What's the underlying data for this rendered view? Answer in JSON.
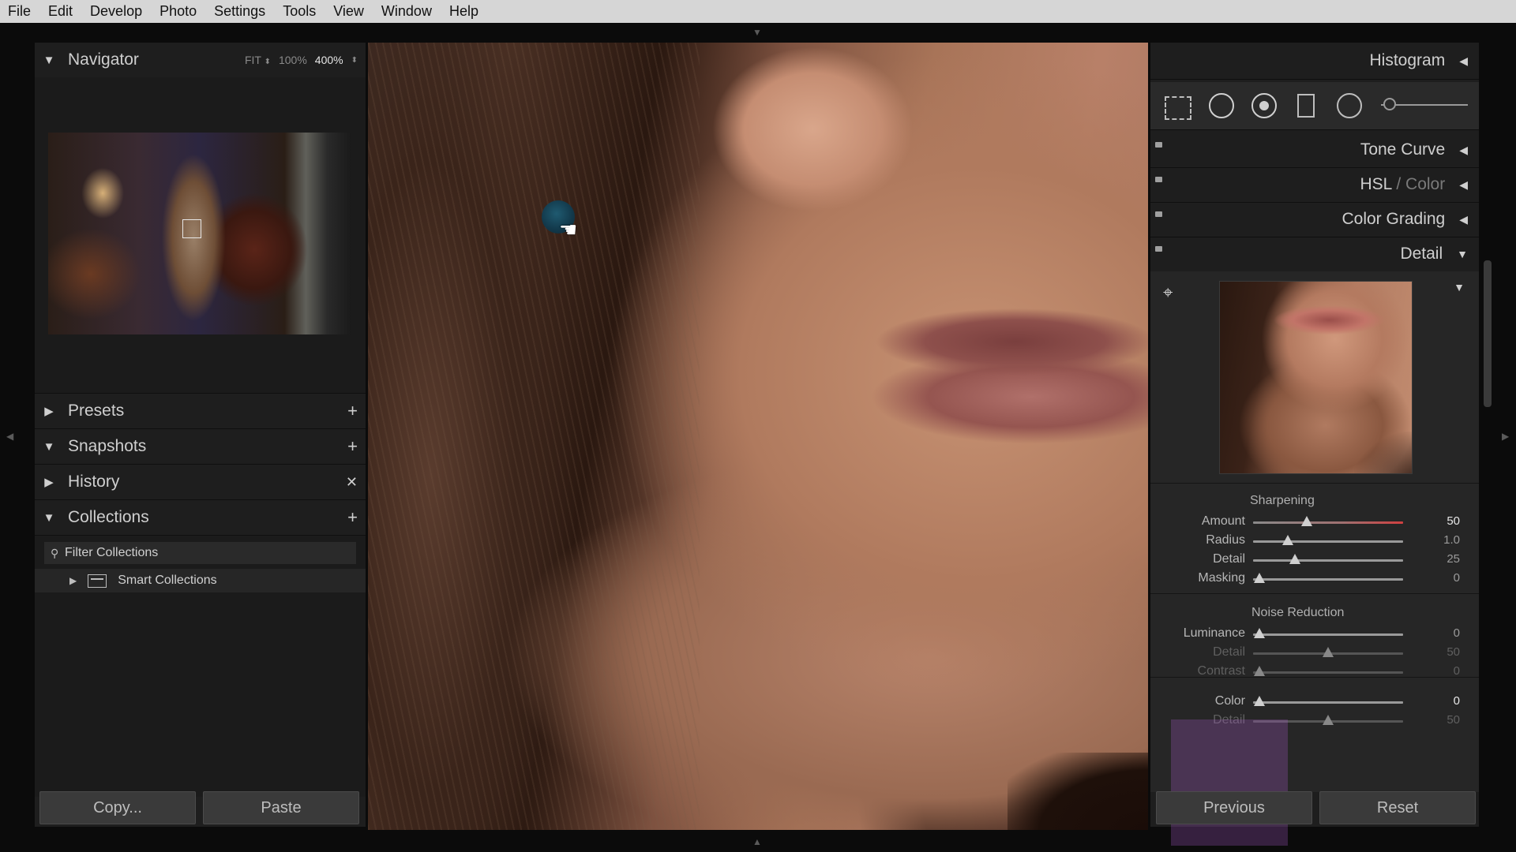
{
  "menu": [
    "File",
    "Edit",
    "Develop",
    "Photo",
    "Settings",
    "Tools",
    "View",
    "Window",
    "Help"
  ],
  "left": {
    "navigator": {
      "title": "Navigator",
      "zoom_fit": "FIT",
      "zoom_100": "100%",
      "zoom_current": "400%"
    },
    "presets": {
      "title": "Presets"
    },
    "snapshots": {
      "title": "Snapshots"
    },
    "history": {
      "title": "History"
    },
    "collections": {
      "title": "Collections",
      "filter_label": "Filter Collections",
      "items": [
        {
          "label": "Smart Collections"
        }
      ]
    },
    "buttons": {
      "copy": "Copy...",
      "paste": "Paste"
    }
  },
  "right": {
    "panels": {
      "histogram": "Histogram",
      "tone_curve": "Tone Curve",
      "hsl": "HSL",
      "hsl_sep": " / ",
      "color": "Color",
      "color_grading": "Color Grading",
      "detail": "Detail"
    },
    "sharpening": {
      "title": "Sharpening",
      "sliders": [
        {
          "label": "Amount",
          "value": "50",
          "pos": 0.357
        },
        {
          "label": "Radius",
          "value": "1.0",
          "pos": 0.23
        },
        {
          "label": "Detail",
          "value": "25",
          "pos": 0.28
        },
        {
          "label": "Masking",
          "value": "0",
          "pos": 0.04
        }
      ]
    },
    "noise_reduction": {
      "title": "Noise Reduction",
      "sliders": [
        {
          "label": "Luminance",
          "value": "0",
          "pos": 0.04
        },
        {
          "label": "Detail",
          "value": "50",
          "pos": 0.5
        },
        {
          "label": "Contrast",
          "value": "0",
          "pos": 0.04
        },
        {
          "label": "Color",
          "value": "0",
          "pos": 0.04
        },
        {
          "label": "Detail",
          "value": "50",
          "pos": 0.5
        }
      ]
    },
    "buttons": {
      "previous": "Previous",
      "reset": "Reset"
    }
  }
}
